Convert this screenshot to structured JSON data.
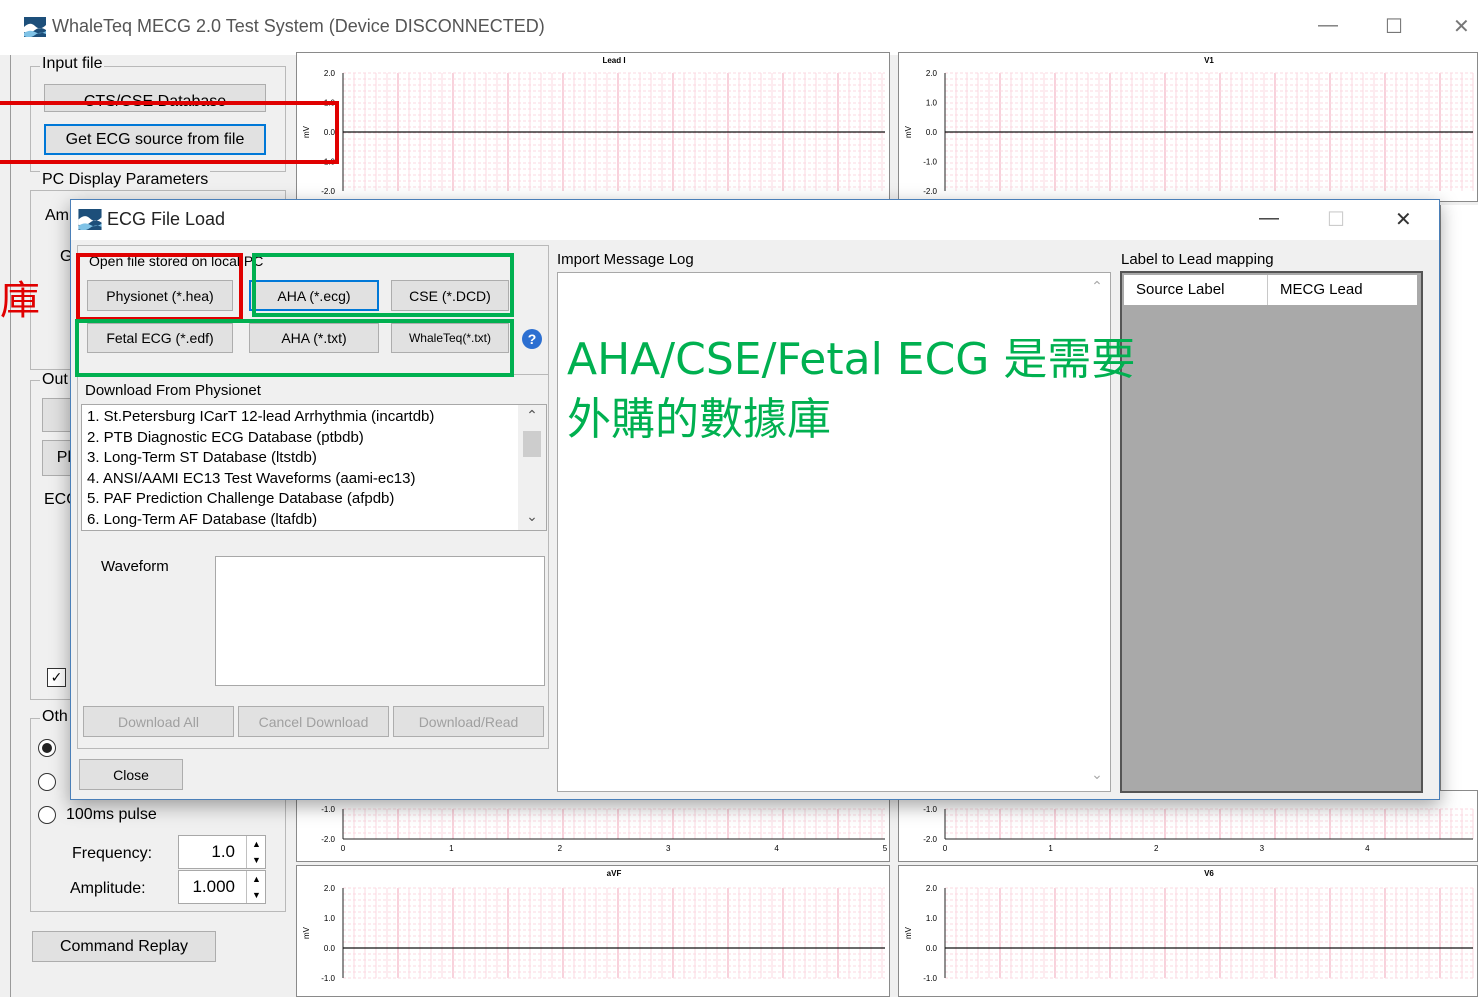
{
  "window": {
    "title": "WhaleTeq MECG 2.0 Test System (Device DISCONNECTED)",
    "controls": {
      "minimize": "—",
      "maximize": "☐",
      "close": "✕"
    }
  },
  "left_panel": {
    "input_file_group": "Input file",
    "cts_cse_button": "CTS/CSE Database",
    "get_ecg_button": "Get ECG source from file",
    "pc_display_group": "PC Display Parameters",
    "amplitude_label_partial": "Am",
    "gain_label_partial": "G",
    "output_group_partial": "Out",
    "play_button_partial": "Pl",
    "ecg_label_partial": "ECG",
    "other_group_partial": "Oth",
    "radio_100ms_label": "100ms pulse",
    "frequency_label": "Frequency:",
    "frequency_value": "1.0",
    "amplitude_label": "Amplitude:",
    "amplitude_value": "1.000",
    "command_replay_button": "Command Replay",
    "annotation_partial": "庫"
  },
  "charts": {
    "ylabel": "mV",
    "top_left": {
      "title": "Lead I",
      "yticks": [
        "2.0",
        "1.0",
        "0.0",
        "-1.0",
        "-2.0"
      ]
    },
    "top_right": {
      "title": "V1",
      "yticks": [
        "2.0",
        "1.0",
        "0.0",
        "-1.0",
        "-2.0"
      ]
    },
    "mid_left": {
      "yticks": [
        "-1.0",
        "-2.0"
      ],
      "xticks": [
        "0",
        "1",
        "2",
        "3",
        "4",
        "5"
      ]
    },
    "mid_right": {
      "yticks": [
        "-1.0",
        "-2.0"
      ],
      "xticks": [
        "0",
        "1",
        "2",
        "3",
        "4"
      ]
    },
    "bottom_left": {
      "title": "aVF",
      "yticks": [
        "2.0",
        "1.0",
        "0.0",
        "-1.0"
      ]
    },
    "bottom_right": {
      "title": "V6",
      "yticks": [
        "2.0",
        "1.0",
        "0.0",
        "-1.0"
      ]
    }
  },
  "dialog": {
    "title": "ECG File Load",
    "controls": {
      "minimize": "—",
      "maximize": "☐",
      "close": "✕"
    },
    "open_file_group": "Open file stored on local PC",
    "buttons": {
      "physionet": "Physionet (*.hea)",
      "aha_ecg": "AHA (*.ecg)",
      "cse_dcd": "CSE (*.DCD)",
      "fetal_ecg": "Fetal ECG (*.edf)",
      "aha_txt": "AHA (*.txt)",
      "whaleteq_txt": "WhaleTeq(*.txt)",
      "help": "?"
    },
    "download_group": "Download From Physionet",
    "physionet_list": [
      "1.  St.Petersburg ICarT 12-lead Arrhythmia (incartdb)",
      "2.  PTB Diagnostic ECG Database (ptbdb)",
      "3.  Long-Term ST Database (ltstdb)",
      "4.  ANSI/AAMI EC13 Test Waveforms (aami-ec13)",
      "5.  PAF Prediction Challenge Database (afpdb)",
      "6.  Long-Term AF Database (ltafdb)"
    ],
    "waveform_label": "Waveform",
    "download_all": "Download All",
    "cancel_download": "Cancel Download",
    "download_read": "Download/Read",
    "close_button": "Close",
    "import_log_label": "Import Message Log",
    "label_mapping_label": "Label to Lead mapping",
    "mapping_columns": [
      "Source Label",
      "MECG Lead"
    ]
  },
  "annotation": {
    "text_line1": "AHA/CSE/Fetal ECG 是需要",
    "text_line2": "外購的數據庫",
    "red_color": "#e00000",
    "green_color": "#00b050"
  }
}
